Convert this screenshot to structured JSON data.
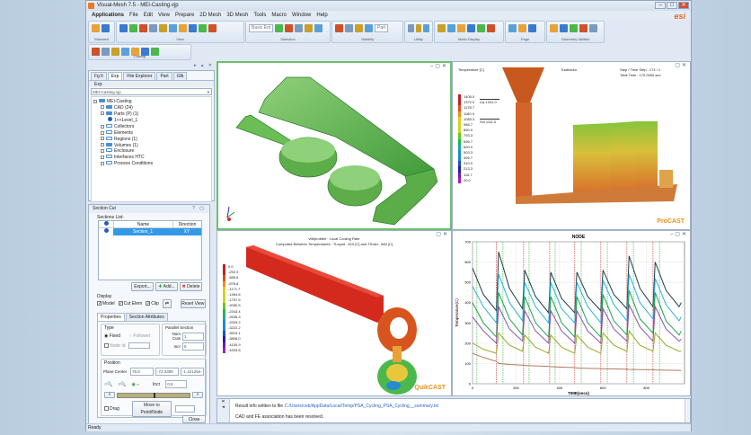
{
  "window": {
    "title": "Visual-Mesh 7.5 - MEI-Casting.vjp",
    "controls": [
      "–",
      "□",
      "✕"
    ],
    "logo": "esi"
  },
  "menu": [
    "Applications",
    "File",
    "Edit",
    "View",
    "Prepare",
    "2D Mesh",
    "3D Mesh",
    "Tools",
    "Macro",
    "Window",
    "Help"
  ],
  "ribbon": {
    "groups": [
      {
        "label": "Standard",
        "icons": [
          "open-folder-icon",
          "save-icon"
        ]
      },
      {
        "label": "View",
        "icons": [
          "fit-view-icon",
          "shade-icon",
          "cube-icon",
          "wireframe-icon",
          "add-view-icon",
          "remove-view-icon",
          "axis-icon",
          "pan-icon",
          "zoom-box-icon",
          "anchor-icon"
        ]
      },
      {
        "label": "Selection",
        "box": "Basic Ent",
        "icons": [
          "pointer-icon",
          "select-icon",
          "pick-icon",
          "pick-part-icon",
          "zoom-select-icon"
        ]
      },
      {
        "label": "Visibility",
        "select": "Part",
        "icons": [
          "eye-icon",
          "show-icon",
          "hide-icon",
          "gear-icon"
        ]
      },
      {
        "label": "Utility",
        "icons": [
          "measure-icon",
          "ruler-icon",
          "table-icon"
        ]
      },
      {
        "label": "Mesh Display",
        "icons": [
          "mesh-1-icon",
          "mesh-2-icon",
          "mesh-3-icon",
          "mesh-4-icon",
          "mesh-5-icon",
          "mesh-6-icon"
        ]
      },
      {
        "label": "Page",
        "icons": [
          "arrow-left-icon",
          "arrow-right-icon",
          "grid-icon"
        ]
      },
      {
        "label": "Geometry Utilities",
        "icons": [
          "curve-icon",
          "circle-icon",
          "point-icon",
          "link-icon",
          "surface-icon"
        ]
      }
    ],
    "casting": {
      "label": "Casting",
      "icons": [
        "casting-zoom-icon",
        "user-icon",
        "copy-icon",
        "mesh-tool-icon",
        "search-icon",
        "network-icon",
        "pin-icon"
      ]
    }
  },
  "explorer": {
    "tabs": [
      "Fg lt",
      "Exp",
      "File Explorer",
      "Part",
      "Glb"
    ],
    "active_tab": 1,
    "toolbar_label": "Exp",
    "combo": "MEI-Casting.vjp",
    "tree": [
      {
        "label": "MEI-Casting",
        "level": 0,
        "type": "folder"
      },
      {
        "label": "CAD (24)",
        "level": 1,
        "type": "folder"
      },
      {
        "label": "Parts (P) (1)",
        "level": 1,
        "type": "folder"
      },
      {
        "label": "1<<Level_1",
        "level": 2,
        "type": "part"
      },
      {
        "label": "Collectors",
        "level": 1,
        "type": "empty"
      },
      {
        "label": "Elements",
        "level": 1,
        "type": "empty"
      },
      {
        "label": "Regions (1)",
        "level": 1,
        "type": "empty"
      },
      {
        "label": "Volumes (1)",
        "level": 1,
        "type": "folder"
      },
      {
        "label": "Enclosure",
        "level": 1,
        "type": "empty"
      },
      {
        "label": "Interfaces HTC",
        "level": 1,
        "type": "empty"
      },
      {
        "label": "Process Conditions",
        "level": 1,
        "type": "empty"
      }
    ]
  },
  "section_cut": {
    "title": "Section Cut",
    "list_label": "Sections List:",
    "columns": [
      "Name",
      "Direction"
    ],
    "rows": [
      {
        "name": "Section_1",
        "direction": "XY"
      }
    ],
    "export": "Export...",
    "add": "Add...",
    "delete": "Delete",
    "display_label": "Display",
    "display": [
      {
        "label": "Model",
        "checked": true
      },
      {
        "label": "Cut Elem",
        "checked": true
      },
      {
        "label": "Clip",
        "checked": true
      }
    ],
    "reset_view": "Reset View",
    "tabs": [
      "Properties",
      "Section Attributes"
    ],
    "type_label": "Type",
    "fixed": "Fixed",
    "follower": "Follower",
    "node_id": "Node Id",
    "parallel_label": "Parallel Section",
    "num_cuts_label": "Num Cuts",
    "num_cuts": "1",
    "incr_label": "Incr",
    "incr": "5",
    "position_label": "Position",
    "plane_center_label": "Plane Center",
    "plane_center": [
      "76.5",
      "-72.3385",
      "-1.42125e-"
    ],
    "incr2_label": "Incr",
    "incr2": "0.5",
    "slider_value": 0.5,
    "drag": "Drag",
    "move_to": "Move to Point/Node",
    "close": "Close"
  },
  "viewports": {
    "procast": {
      "header_left": "Temperature [C]",
      "header_mid": "Tradriarko",
      "step_label": "Step / Time Step",
      "step_value": "174 / 1",
      "time_label": "Total   Time",
      "time_value": "170.0000 sec",
      "legend": [
        "1405.0",
        "1372.0",
        "1276.7",
        "1180.0",
        "1083.3",
        "986.7",
        "890.0",
        "793.3",
        "696.7",
        "600.0",
        "503.3",
        "406.7",
        "310.0",
        "213.3",
        "116.7",
        "20.0"
      ],
      "liq": "Liq   1331.0",
      "sol": "Sol   1111.0",
      "brand": "ProCAST"
    },
    "quikcast": {
      "title": "vtMprobble : Local Cooling Rate",
      "subtitle": "Computed Between Temperatures : TLiquid - 610 [C]  and TSolid - 580 [C]",
      "legend": [
        "0.0",
        "-292.9",
        "-585.8",
        "-878.8",
        "-1171.7",
        "-1464.6",
        "-1757.5",
        "-2050.5",
        "-2343.4",
        "-2636.3",
        "-2929.2",
        "-3222.2",
        "-3515.1",
        "-3808.0",
        "-4100.9",
        "-4393.8"
      ],
      "brand": "QuikCAST"
    }
  },
  "chart_data": {
    "type": "line",
    "title": "NODE",
    "xlabel": "TIME(secs)",
    "ylabel": "Temperature(C)",
    "xlim": [
      0,
      975
    ],
    "ylim": [
      0,
      700
    ],
    "xticks": [
      0,
      200,
      400,
      600,
      800
    ],
    "yticks": [
      0,
      100,
      200,
      300,
      400,
      500,
      600,
      700
    ],
    "grid": true,
    "x": [
      0,
      50,
      110,
      120,
      170,
      230,
      240,
      290,
      350,
      360,
      410,
      470,
      480,
      530,
      590,
      600,
      650,
      710,
      720,
      770,
      830,
      840,
      890,
      950,
      960
    ],
    "series": [
      {
        "color": "#1d3f4a",
        "values": [
          570,
          440,
          360,
          650,
          470,
          370,
          560,
          430,
          350,
          550,
          420,
          350,
          550,
          430,
          360,
          560,
          440,
          370,
          630,
          470,
          380,
          600,
          460,
          380,
          400
        ]
      },
      {
        "color": "#2bb3d6",
        "values": [
          480,
          380,
          300,
          540,
          400,
          310,
          500,
          380,
          300,
          500,
          370,
          300,
          500,
          380,
          300,
          510,
          390,
          310,
          540,
          400,
          320,
          520,
          390,
          310,
          330
        ]
      },
      {
        "color": "#1e9e4a",
        "values": [
          400,
          300,
          230,
          450,
          320,
          240,
          430,
          300,
          230,
          430,
          300,
          230,
          430,
          300,
          230,
          440,
          310,
          240,
          460,
          320,
          250,
          450,
          310,
          240,
          260
        ]
      },
      {
        "color": "#8a4fb0",
        "values": [
          330,
          260,
          200,
          380,
          270,
          210,
          360,
          260,
          200,
          360,
          260,
          200,
          360,
          260,
          200,
          370,
          270,
          210,
          390,
          280,
          210,
          380,
          270,
          210,
          220
        ]
      },
      {
        "color": "#9aa82a",
        "values": [
          200,
          170,
          150,
          250,
          190,
          160,
          240,
          180,
          150,
          240,
          180,
          150,
          240,
          180,
          150,
          250,
          190,
          160,
          260,
          190,
          160,
          250,
          190,
          160,
          160
        ]
      },
      {
        "color": "#b07a60",
        "values": [
          150,
          130,
          110,
          100,
          95,
          92,
          90,
          88,
          86,
          84,
          82,
          80,
          78,
          76,
          75,
          74,
          73,
          72,
          71,
          70,
          69,
          68,
          67,
          66,
          65
        ]
      }
    ],
    "markers": {
      "red": [
        110,
        235,
        355,
        470,
        590,
        710,
        830
      ],
      "green": [
        20,
        140,
        260,
        380,
        500,
        620,
        740,
        860
      ]
    }
  },
  "log": {
    "line1_prefix": "Result info written to file",
    "line1_link": "C:/Users/ceb/AppData/Local/Temp/PSA_Cycling_PSA_Cycling__summary.txt",
    "line2": "CAD and FE association has been resolved."
  },
  "status": "Ready"
}
